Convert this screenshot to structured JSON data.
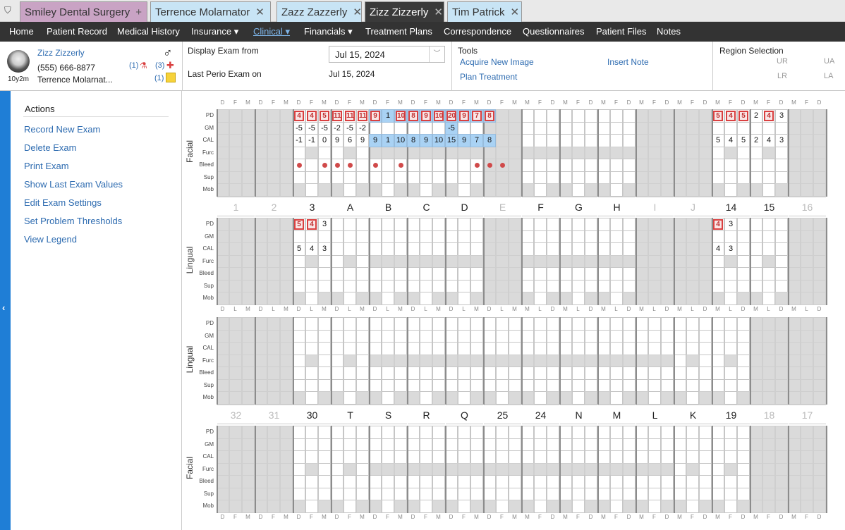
{
  "tabs": [
    {
      "label": "Smiley Dental Surgery",
      "icon": "plus-icon",
      "bg": "#c9a3c4",
      "active": false
    },
    {
      "label": "Terrence Molarnator",
      "icon": "close-icon",
      "bg": "#c8e4f5",
      "active": false
    },
    {
      "label": "Zazz Zazzerly",
      "icon": "close-icon",
      "bg": "#c8e4f5",
      "active": false
    },
    {
      "label": "Zizz Zizzerly",
      "icon": "close-icon",
      "bg": "#3a3a3a",
      "active": true
    },
    {
      "label": "Tim Patrick",
      "icon": "close-icon",
      "bg": "#c8e4f5",
      "active": false
    }
  ],
  "nav": [
    {
      "label": "Home"
    },
    {
      "label": "Patient Record"
    },
    {
      "label": "Medical History"
    },
    {
      "label": "Insurance ▾"
    },
    {
      "label": "Clinical ▾",
      "active": true
    },
    {
      "label": "Financials ▾"
    },
    {
      "label": "Treatment Plans"
    },
    {
      "label": "Correspondence"
    },
    {
      "label": "Questionnaires"
    },
    {
      "label": "Patient Files"
    },
    {
      "label": "Notes"
    }
  ],
  "patient": {
    "name": "Zizz Zizzerly",
    "phone": "(555) 666-8877",
    "age": "10y2m",
    "provider": "Terrence Molarnat...",
    "gender_symbol": "♂",
    "lab_count": "(1)",
    "alert_count": "(3)",
    "note_count": "(1)"
  },
  "exam": {
    "display_label": "Display Exam from",
    "display_value": "Jul 15, 2024",
    "last_label": "Last Perio Exam on",
    "last_value": "Jul 15, 2024"
  },
  "tools": {
    "title": "Tools",
    "items": [
      "Acquire New Image",
      "Insert Note",
      "Plan Treatment"
    ]
  },
  "region": {
    "title": "Region Selection",
    "ur": "UR",
    "ua": "UA",
    "lr": "LR",
    "la": "LA"
  },
  "actions": {
    "title": "Actions",
    "items": [
      "Record New Exam",
      "Delete Exam",
      "Print Exam",
      "Show Last Exam Values",
      "Edit Exam Settings",
      "Set Problem Thresholds",
      "View Legend"
    ]
  },
  "perio": {
    "rows": [
      "PD",
      "GM",
      "CAL",
      "Furc",
      "Bleed",
      "Sup",
      "Mob"
    ],
    "facial_label": "Facial",
    "lingual_label": "Lingual",
    "top_teeth": [
      "1",
      "2",
      "3",
      "A",
      "B",
      "C",
      "D",
      "E",
      "F",
      "G",
      "H",
      "I",
      "J",
      "14",
      "15",
      "16"
    ],
    "bottom_teeth": [
      "32",
      "31",
      "30",
      "T",
      "S",
      "R",
      "Q",
      "25",
      "24",
      "N",
      "M",
      "L",
      "K",
      "19",
      "18",
      "17"
    ],
    "missing_top": [
      0,
      1,
      7,
      11,
      12,
      15
    ],
    "missing_bottom": [
      0,
      1,
      14,
      15
    ],
    "sites_dfm": [
      "D",
      "F",
      "M",
      "M",
      "F",
      "D"
    ],
    "sites_dlm": [
      "D",
      "L",
      "M",
      "M",
      "L",
      "D"
    ],
    "uf_pd": [
      {
        "col": 6,
        "v": "4",
        "r": true
      },
      {
        "col": 7,
        "v": "4",
        "r": true
      },
      {
        "col": 8,
        "v": "5",
        "r": true
      },
      {
        "col": 9,
        "v": "11",
        "r": true
      },
      {
        "col": 10,
        "v": "11",
        "r": true
      },
      {
        "col": 11,
        "v": "11",
        "r": true
      },
      {
        "col": 12,
        "v": "9",
        "r": true
      },
      {
        "col": 13,
        "v": "1"
      },
      {
        "col": 14,
        "v": "10",
        "r": true
      },
      {
        "col": 15,
        "v": "8",
        "r": true
      },
      {
        "col": 16,
        "v": "9",
        "r": true
      },
      {
        "col": 17,
        "v": "10",
        "r": true
      },
      {
        "col": 18,
        "v": "20",
        "r": true
      },
      {
        "col": 19,
        "v": "9",
        "r": true
      },
      {
        "col": 20,
        "v": "7",
        "r": true
      },
      {
        "col": 21,
        "v": "8",
        "r": true
      },
      {
        "col": 39,
        "v": "5",
        "r": true
      },
      {
        "col": 40,
        "v": "4",
        "r": true
      },
      {
        "col": 41,
        "v": "5",
        "r": true
      },
      {
        "col": 42,
        "v": "2"
      },
      {
        "col": 43,
        "v": "4",
        "r": true
      },
      {
        "col": 44,
        "v": "3"
      }
    ],
    "uf_gm": [
      {
        "col": 6,
        "v": "-5"
      },
      {
        "col": 7,
        "v": "-5"
      },
      {
        "col": 8,
        "v": "-5"
      },
      {
        "col": 9,
        "v": "-2"
      },
      {
        "col": 10,
        "v": "-5"
      },
      {
        "col": 11,
        "v": "-2"
      },
      {
        "col": 18,
        "v": "-5"
      }
    ],
    "uf_cal": [
      {
        "col": 6,
        "v": "-1"
      },
      {
        "col": 7,
        "v": "-1"
      },
      {
        "col": 8,
        "v": "0"
      },
      {
        "col": 9,
        "v": "9"
      },
      {
        "col": 10,
        "v": "6"
      },
      {
        "col": 11,
        "v": "9"
      },
      {
        "col": 12,
        "v": "9"
      },
      {
        "col": 13,
        "v": "1"
      },
      {
        "col": 14,
        "v": "10"
      },
      {
        "col": 15,
        "v": "8"
      },
      {
        "col": 16,
        "v": "9"
      },
      {
        "col": 17,
        "v": "10"
      },
      {
        "col": 18,
        "v": "15"
      },
      {
        "col": 19,
        "v": "9"
      },
      {
        "col": 20,
        "v": "7"
      },
      {
        "col": 21,
        "v": "8"
      },
      {
        "col": 39,
        "v": "5"
      },
      {
        "col": 40,
        "v": "4"
      },
      {
        "col": 41,
        "v": "5"
      },
      {
        "col": 42,
        "v": "2"
      },
      {
        "col": 43,
        "v": "4"
      },
      {
        "col": 44,
        "v": "3"
      }
    ],
    "uf_bleed": [
      6,
      8,
      9,
      10,
      12,
      14,
      20,
      21,
      22
    ],
    "ul_pd": [
      {
        "col": 6,
        "v": "5",
        "r": true
      },
      {
        "col": 7,
        "v": "4",
        "r": true
      },
      {
        "col": 8,
        "v": "3"
      },
      {
        "col": 39,
        "v": "4",
        "r": true
      },
      {
        "col": 40,
        "v": "3"
      }
    ],
    "ul_cal": [
      {
        "col": 6,
        "v": "5"
      },
      {
        "col": 7,
        "v": "4"
      },
      {
        "col": 8,
        "v": "3"
      },
      {
        "col": 39,
        "v": "4"
      },
      {
        "col": 40,
        "v": "3"
      }
    ]
  },
  "colors": {
    "accent": "#1f7ed6",
    "alert": "#d94040",
    "nav_bg": "#333333"
  }
}
